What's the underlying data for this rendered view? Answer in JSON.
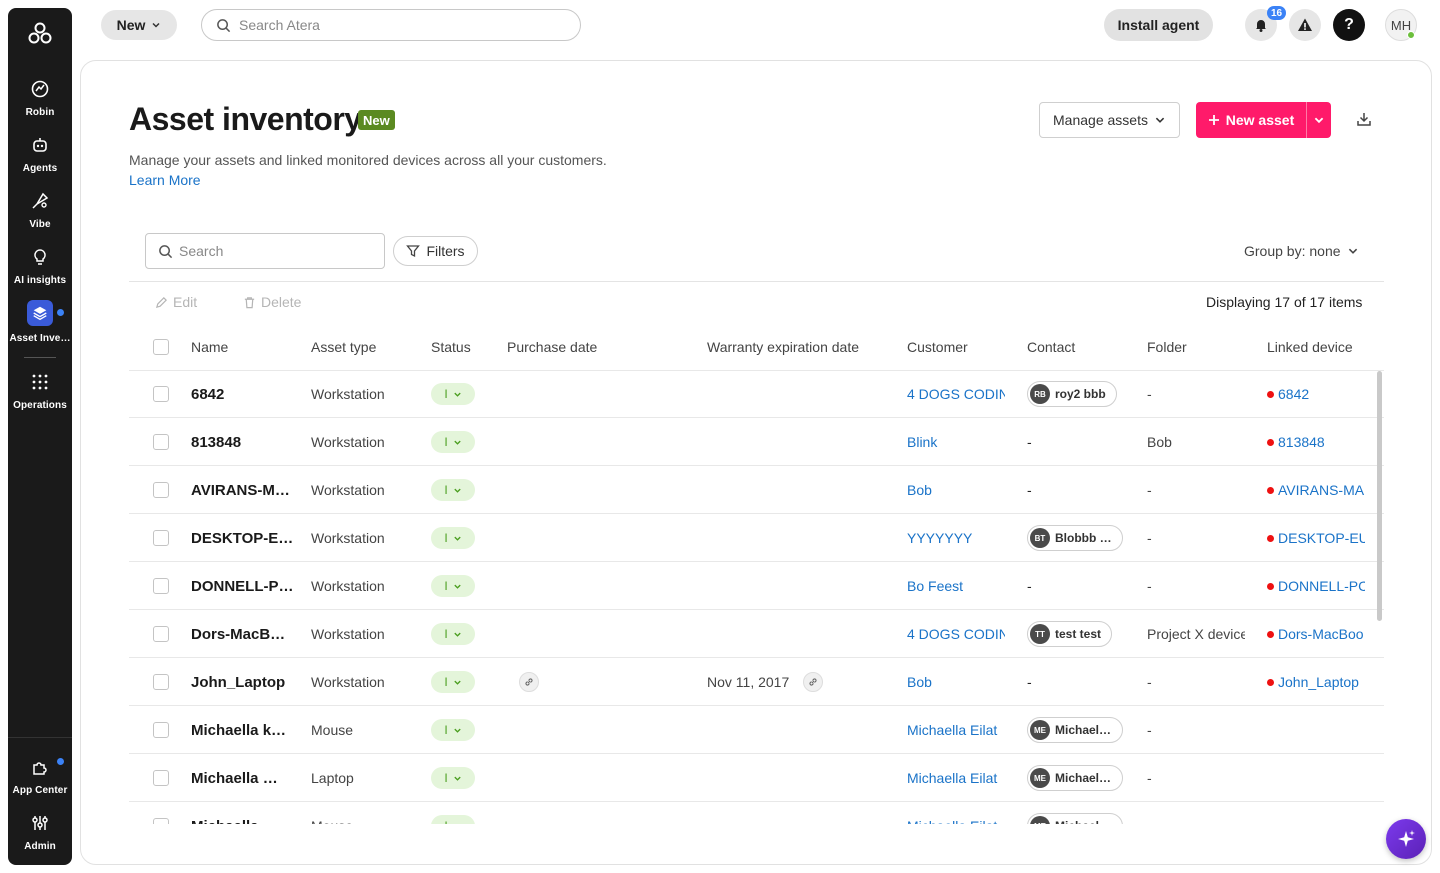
{
  "sidebar": {
    "items": [
      {
        "label": "Robin",
        "icon": "robin-icon"
      },
      {
        "label": "Agents",
        "icon": "agents-icon"
      },
      {
        "label": "Vibe",
        "icon": "vibe-icon"
      },
      {
        "label": "AI insights",
        "icon": "ai-insights-icon"
      },
      {
        "label": "Asset Inve…",
        "icon": "asset-inventory-icon"
      },
      {
        "label": "Operations",
        "icon": "operations-icon"
      }
    ],
    "bottom": [
      {
        "label": "App Center",
        "icon": "app-center-icon"
      },
      {
        "label": "Admin",
        "icon": "admin-icon"
      }
    ]
  },
  "topbar": {
    "new_label": "New",
    "search_placeholder": "Search Atera",
    "install_label": "Install agent",
    "notif_count": "16",
    "help_label": "?",
    "avatar_initials": "MH"
  },
  "page": {
    "title": "Asset inventory",
    "new_badge": "New",
    "subtitle": "Manage your assets and linked monitored devices across all your customers.",
    "learn_more": "Learn More",
    "manage_assets": "Manage assets",
    "new_asset": "New asset",
    "search_placeholder": "Search",
    "filters": "Filters",
    "group_by": "Group by: none",
    "edit": "Edit",
    "delete": "Delete",
    "displaying": "Displaying 17 of 17 items"
  },
  "table": {
    "headers": [
      "Name",
      "Asset type",
      "Status",
      "Purchase date",
      "Warranty expiration date",
      "Customer",
      "Contact",
      "Folder",
      "Linked device"
    ],
    "rows": [
      {
        "name": "6842",
        "type": "Workstation",
        "status": "I",
        "purchase": "",
        "warranty": "",
        "customer": "4 DOGS CODIN(",
        "contact": "roy2 bbb",
        "contact_initials": "RB",
        "folder": "-",
        "device": "6842"
      },
      {
        "name": "813848",
        "type": "Workstation",
        "status": "I",
        "purchase": "",
        "warranty": "",
        "customer": "Blink",
        "contact": "",
        "contact_initials": "",
        "contact_text": "-",
        "folder": "Bob",
        "device": "813848"
      },
      {
        "name": "AVIRANS-M…",
        "type": "Workstation",
        "status": "I",
        "purchase": "",
        "warranty": "",
        "customer": "Bob",
        "contact": "",
        "contact_initials": "",
        "contact_text": "-",
        "folder": "-",
        "device": "AVIRANS-MA("
      },
      {
        "name": "DESKTOP-E…",
        "type": "Workstation",
        "status": "I",
        "purchase": "",
        "warranty": "",
        "customer": "YYYYYYY",
        "contact": "Blobbb tt…",
        "contact_initials": "BT",
        "folder": "-",
        "device": "DESKTOP-EU:"
      },
      {
        "name": "DONNELL-P…",
        "type": "Workstation",
        "status": "I",
        "purchase": "",
        "warranty": "",
        "customer": "Bo Feest",
        "contact": "",
        "contact_initials": "",
        "contact_text": "-",
        "folder": "-",
        "device": "DONNELL-PC"
      },
      {
        "name": "Dors-MacB…",
        "type": "Workstation",
        "status": "I",
        "purchase": "",
        "warranty": "",
        "customer": "4 DOGS CODIN(",
        "contact": "test test",
        "contact_initials": "TT",
        "folder": "Project X device",
        "device": "Dors-MacBoo"
      },
      {
        "name": "John_Laptop",
        "type": "Workstation",
        "status": "I",
        "purchase": "",
        "purchase_link": true,
        "warranty": "Nov 11, 2017",
        "customer": "Bob",
        "contact": "",
        "contact_initials": "",
        "contact_text": "-",
        "folder": "-",
        "device": "John_Laptop"
      },
      {
        "name": "Michaella k…",
        "type": "Mouse",
        "status": "I",
        "purchase": "",
        "warranty": "",
        "customer": "Michaella Eilat",
        "contact": "Michaella…",
        "contact_initials": "ME",
        "folder": "-",
        "device": ""
      },
      {
        "name": "Michaella …",
        "type": "Laptop",
        "status": "I",
        "purchase": "",
        "warranty": "",
        "customer": "Michaella Eilat",
        "contact": "Michaella…",
        "contact_initials": "ME",
        "folder": "-",
        "device": ""
      },
      {
        "name": "Michaella…",
        "type": "Mouse",
        "status": "I",
        "purchase": "",
        "warranty": "",
        "customer": "Michaella Eilat",
        "contact": "Michaella…",
        "contact_initials": "ME",
        "folder": "-",
        "device": ""
      }
    ]
  },
  "colors": {
    "accent": "#ff1a6a",
    "link": "#1a73c8",
    "status_bg": "#e4f5da",
    "badge": "#5b8a21",
    "sidebar": "#1a1a1a"
  }
}
